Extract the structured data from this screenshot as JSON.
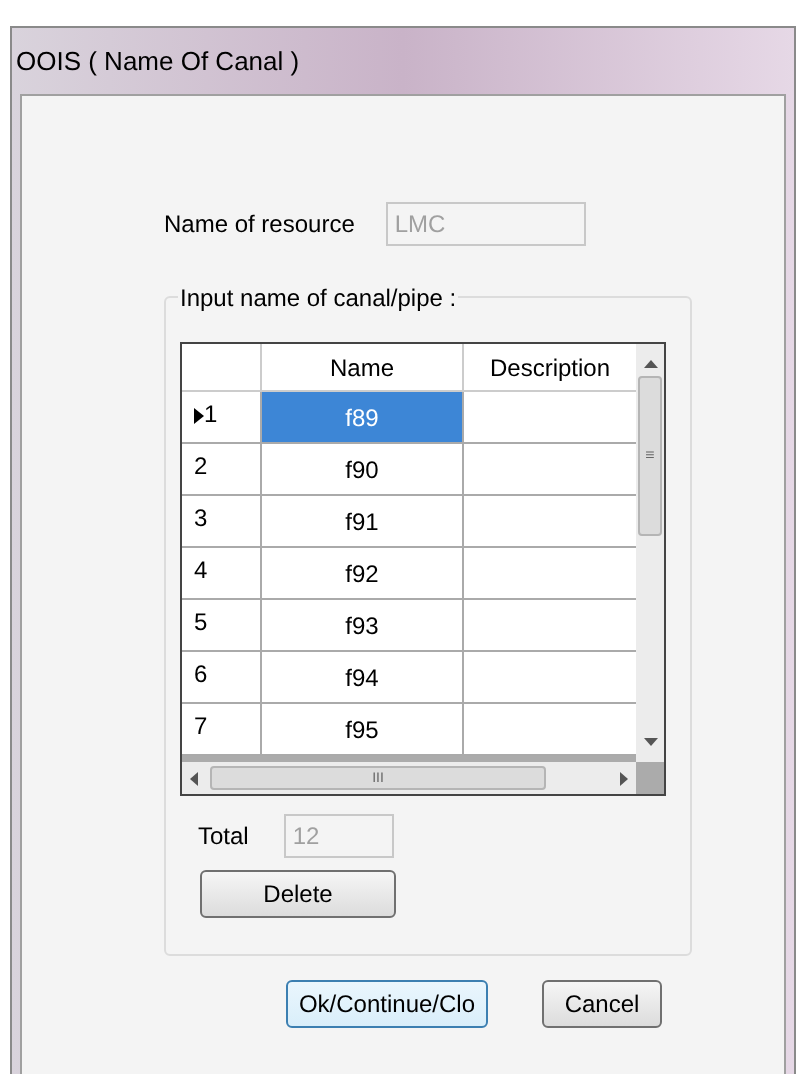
{
  "window": {
    "title": "OOIS ( Name Of Canal  )"
  },
  "resource": {
    "label": "Name of resource",
    "value": "LMC"
  },
  "group": {
    "title": "Input name of canal/pipe :"
  },
  "grid": {
    "columns": [
      "Name",
      "Description"
    ],
    "rows": [
      {
        "number": "1",
        "name": "f89",
        "selected": true
      },
      {
        "number": "2",
        "name": "f90",
        "selected": false
      },
      {
        "number": "3",
        "name": "f91",
        "selected": false
      },
      {
        "number": "4",
        "name": "f92",
        "selected": false
      },
      {
        "number": "5",
        "name": "f93",
        "selected": false
      },
      {
        "number": "6",
        "name": "f94",
        "selected": false
      },
      {
        "number": "7",
        "name": "f95",
        "selected": false
      }
    ],
    "scroll_grip": "≡",
    "hscroll_grip": "III"
  },
  "total": {
    "label": "Total",
    "value": "12"
  },
  "buttons": {
    "delete": "Delete",
    "ok": "Ok/Continue/Clo",
    "cancel": "Cancel"
  }
}
